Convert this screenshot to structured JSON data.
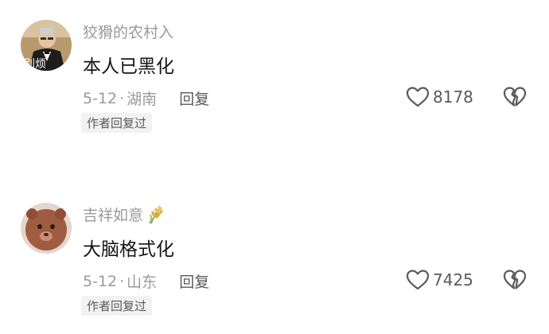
{
  "comments": [
    {
      "username": "狡猾的农村入",
      "avatar_text": "别烦",
      "content": "本人已黑化",
      "date": "5-12",
      "separator": "·",
      "location": "湖南",
      "reply_label": "回复",
      "like_count": "8178",
      "badge": "作者回复过",
      "icons": {
        "like": "heart-outline-icon",
        "dislike": "broken-heart-icon"
      }
    },
    {
      "username": "吉祥如意",
      "username_emoji": "wheat-icon",
      "content": "大脑格式化",
      "date": "5-12",
      "separator": "·",
      "location": "山东",
      "reply_label": "回复",
      "like_count": "7425",
      "badge": "作者回复过",
      "icons": {
        "like": "heart-outline-icon",
        "dislike": "broken-heart-icon"
      }
    }
  ],
  "colors": {
    "username": "#9a9a9a",
    "content": "#161616",
    "secondary": "#5a5a5a",
    "badge_bg": "#f2f2f2",
    "background": "#ffffff"
  }
}
